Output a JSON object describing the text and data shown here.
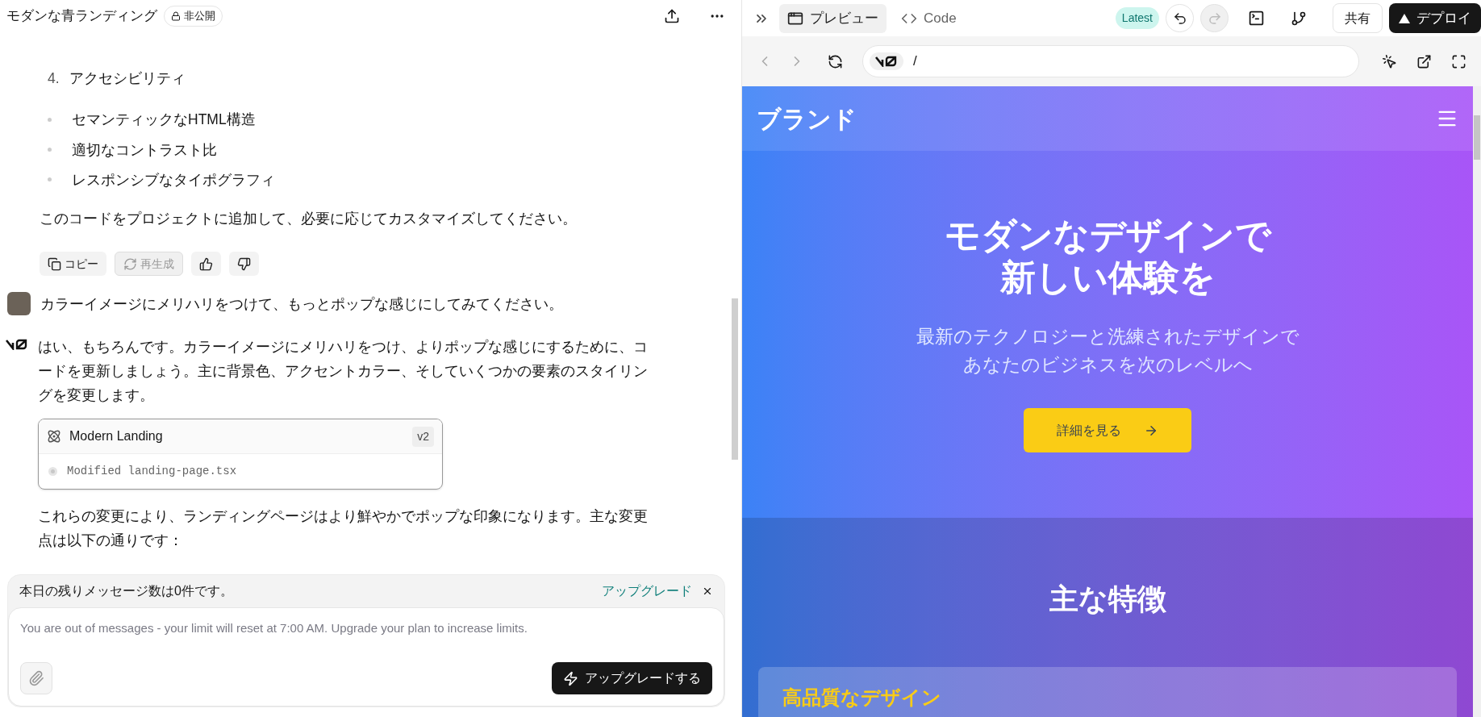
{
  "header": {
    "title": "モダンな青ランディング",
    "badge": "非公開"
  },
  "assistant_tail": {
    "numbered_item": {
      "number": "4.",
      "text": "アクセシビリティ"
    },
    "bullets": [
      "セマンティックなHTML構造",
      "適切なコントラスト比",
      "レスポンシブなタイポグラフィ"
    ],
    "paragraph": "このコードをプロジェクトに追加して、必要に応じてカスタマイズしてください。",
    "actions": [
      {
        "kind": "copy",
        "label": "コピー",
        "disabled": false
      },
      {
        "kind": "regenerate",
        "label": "再生成",
        "disabled": true
      },
      {
        "kind": "like"
      },
      {
        "kind": "dislike"
      }
    ]
  },
  "user_message": {
    "text": "カラーイメージにメリハリをつけて、もっとポップな感じにしてみてください。"
  },
  "assistant_message": {
    "text": "はい、もちろんです。カラーイメージにメリハリをつけ、よりポップな感じにするために、コードを更新しましょう。主に背景色、アクセントカラー、そしていくつかの要素のスタイリングを変更します。",
    "artifact": {
      "title": "Modern Landing",
      "version": "v2",
      "status": "Modified landing-page.tsx"
    },
    "followup": "これらの変更により、ランディングページはより鮮やかでポップな印象になります。主な変更点は以下の通りです："
  },
  "limit_banner": {
    "text": "本日の残りメッセージ数は0件です。",
    "link": "アップグレード"
  },
  "composer": {
    "placeholder": "You are out of messages - your limit will reset at 7:00 AM. Upgrade your plan to increase limits.",
    "button": "アップグレードする"
  },
  "toolbar": {
    "tabs": [
      {
        "kind": "preview",
        "label": "プレビュー",
        "selected": true
      },
      {
        "kind": "code",
        "label": "Code",
        "selected": false
      }
    ],
    "badge": "Latest",
    "undo_disabled": false,
    "redo_disabled": true,
    "share": "共有",
    "deploy": "デプロイ"
  },
  "address_bar": {
    "path": "/"
  },
  "preview": {
    "brand": "ブランド",
    "hero_title_lines": [
      "モダンなデザインで",
      "新しい体験を"
    ],
    "hero_subtitle_lines": [
      "最新のテクノロジーと洗練されたデザインで",
      "あなたのビジネスを次のレベルへ"
    ],
    "cta": "詳細を見る",
    "features_title": "主な特徴",
    "feature_card_title": "高品質なデザイン"
  }
}
